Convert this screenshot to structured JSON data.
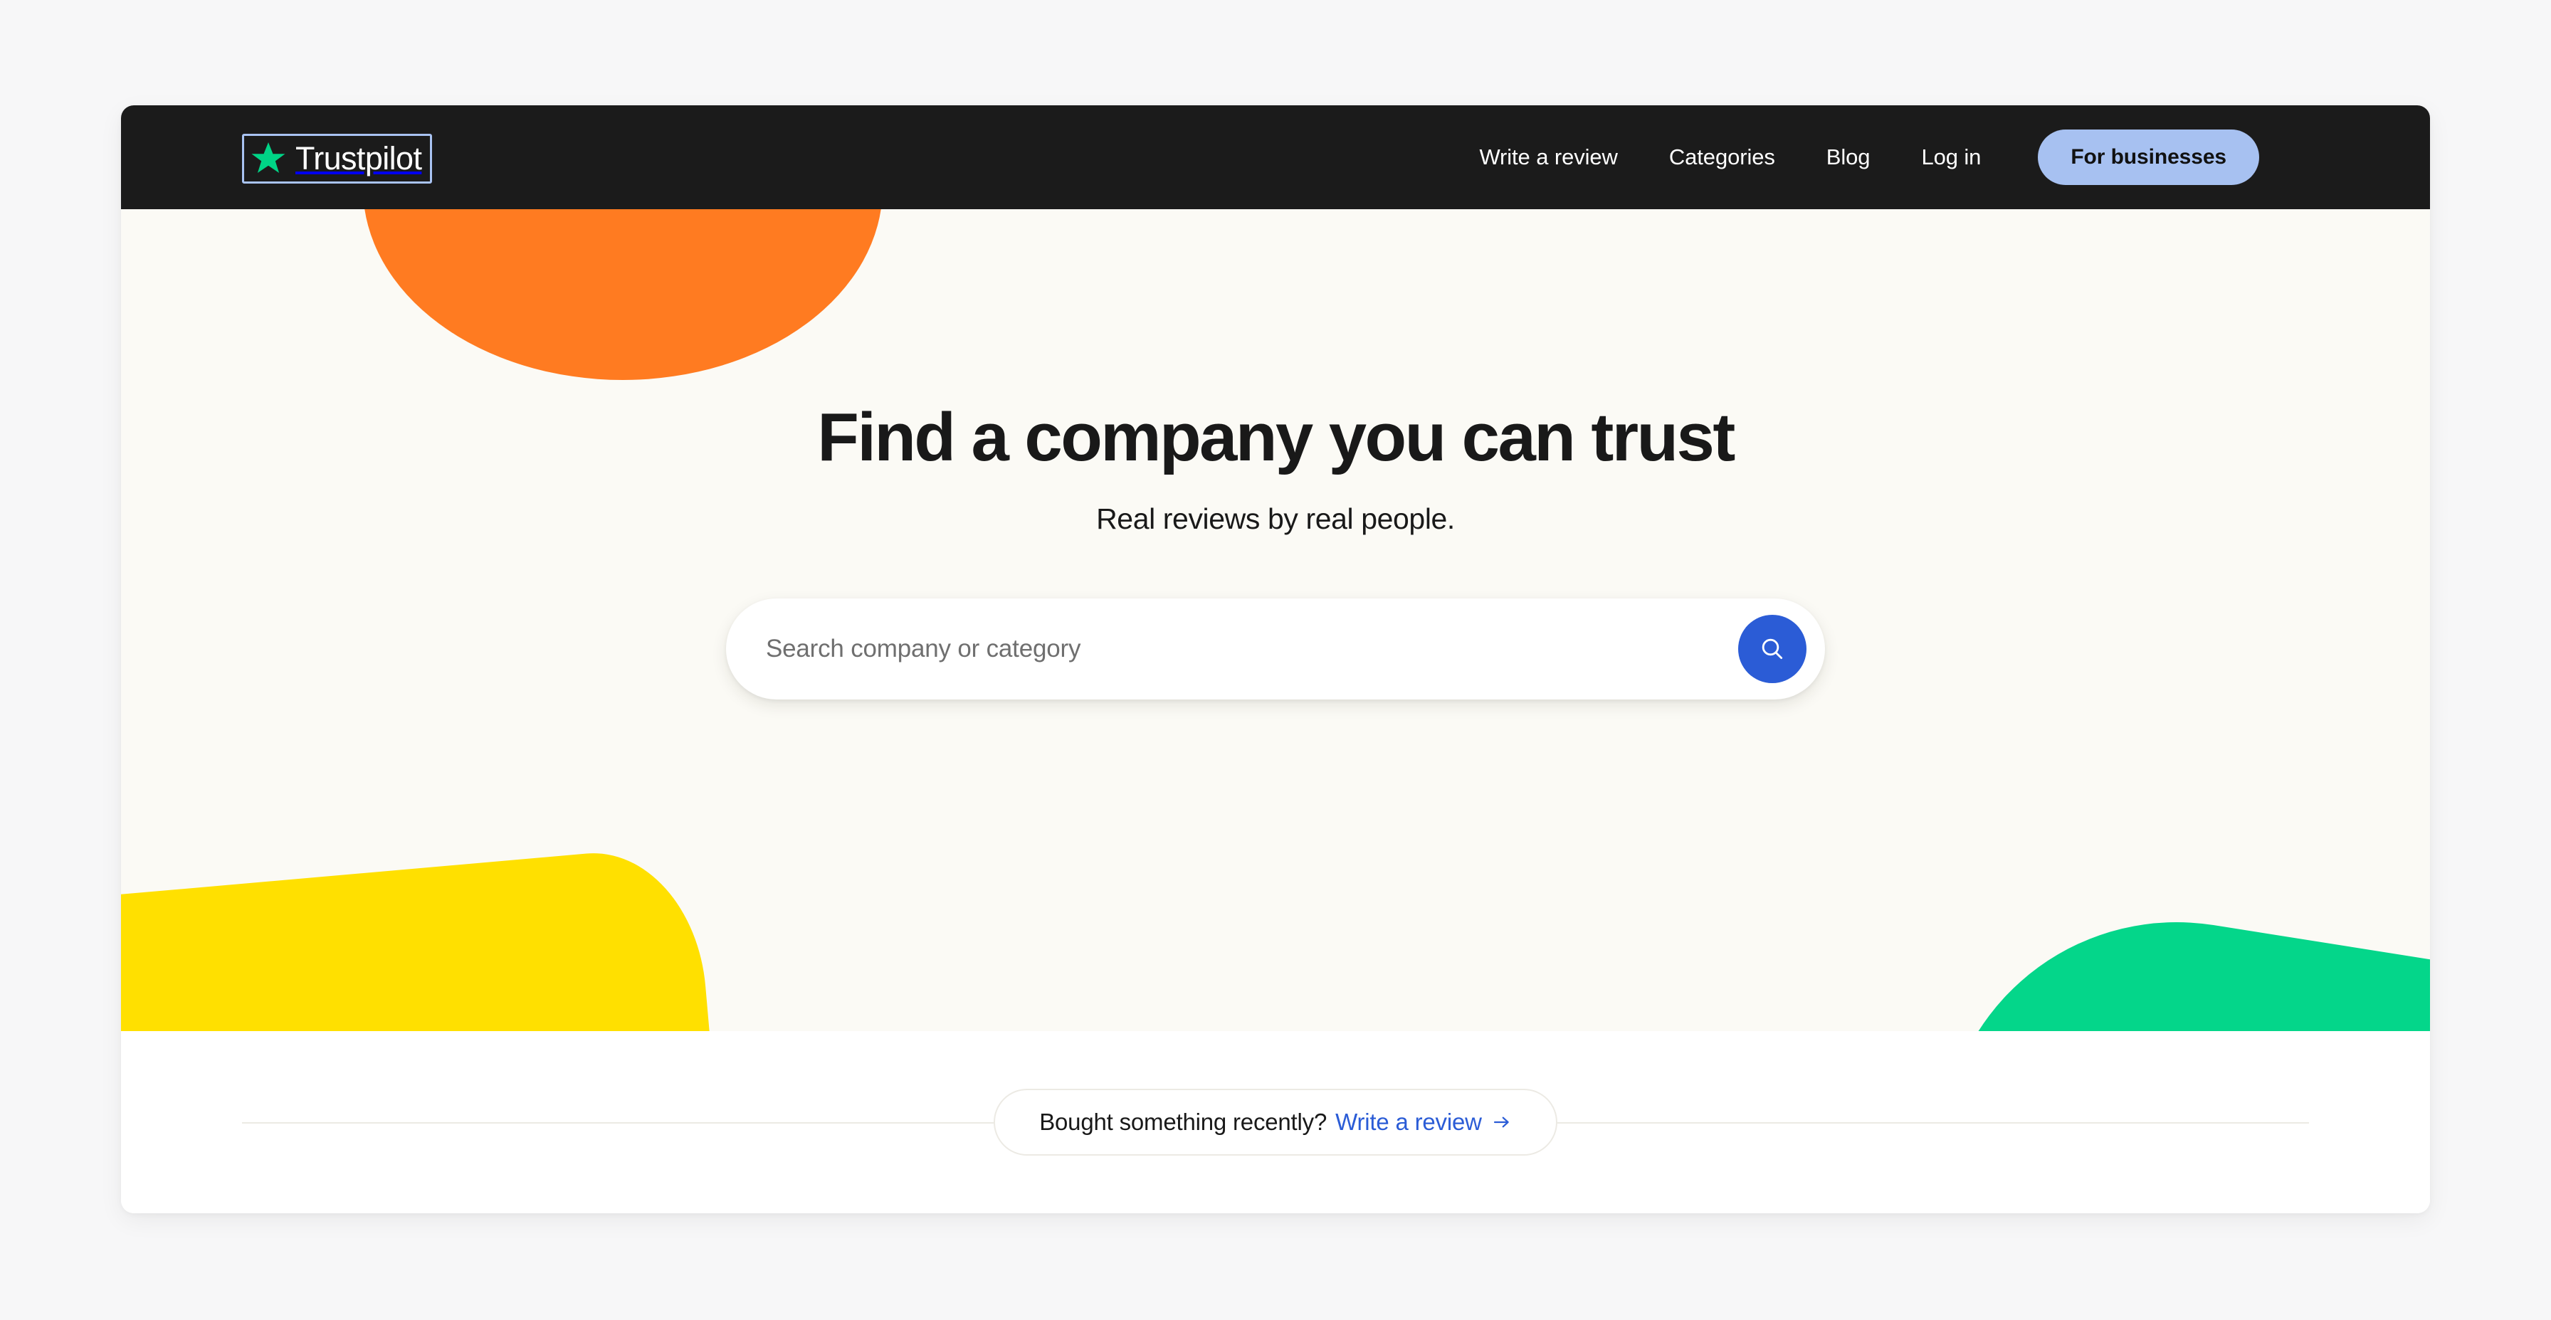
{
  "colors": {
    "page_bg": "#f7f7f8",
    "nav_bg": "#1b1b1b",
    "hero_bg": "#fbfaf5",
    "accent_blue": "#2b5cd6",
    "pill_periwinkle": "#a7c1f1",
    "star_green": "#00d486",
    "blob_orange": "#ff7b21",
    "blob_yellow": "#ffe000",
    "blob_green": "#04d68a",
    "focus_ring": "#a9c3f2",
    "divider": "#eceae4"
  },
  "navbar": {
    "logo": {
      "text": "Trustpilot",
      "star_icon": "star-icon",
      "focused": true
    },
    "links": [
      {
        "label": "Write a review"
      },
      {
        "label": "Categories"
      },
      {
        "label": "Blog"
      },
      {
        "label": "Log in"
      }
    ],
    "business_button": {
      "label": "For businesses"
    }
  },
  "hero": {
    "headline": "Find a company you can trust",
    "subheadline": "Real reviews by real people.",
    "search": {
      "value": "",
      "placeholder": "Search company or category",
      "button_icon": "search-icon"
    },
    "decorations": [
      {
        "name": "orange-blob",
        "shape": "circle"
      },
      {
        "name": "yellow-blob",
        "shape": "rounded-organic"
      },
      {
        "name": "green-blob",
        "shape": "rounded-wedge"
      }
    ]
  },
  "bottom_cta": {
    "text": "Bought something recently?",
    "link_label": "Write a review",
    "arrow_icon": "arrow-right-icon"
  }
}
